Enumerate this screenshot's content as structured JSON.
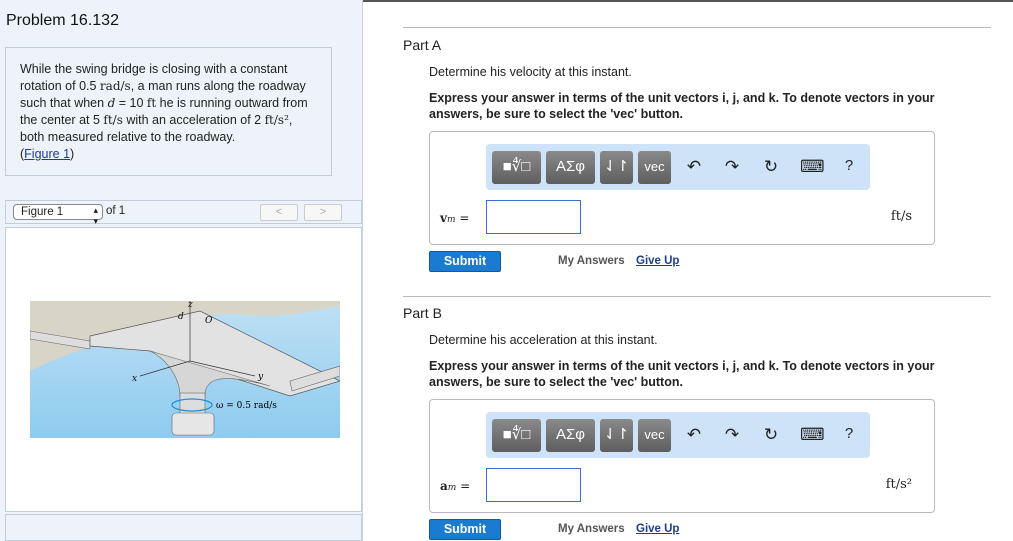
{
  "problem": {
    "title": "Problem 16.132",
    "text": {
      "p1": "While the swing bridge is closing with a constant rotation of 0.5 ",
      "m1": "rad/s",
      "p2": ", a man runs along the roadway such that when ",
      "m2": "d",
      "p3": " = 10 ",
      "m3": "ft",
      "p4": " he is running outward from the center at 5 ",
      "m4": "ft/s",
      "p5": " with an acceleration of 2 ",
      "m5": "ft/s²",
      "p6": ", both measured relative to the roadway.",
      "link_open": "(",
      "link": "Figure 1",
      "link_close": ")"
    }
  },
  "figure": {
    "select": "Figure 1",
    "of": "of 1",
    "prev": "<",
    "next": ">",
    "labels": {
      "z": "z",
      "d": "d",
      "O": "O",
      "x": "x",
      "y": "y",
      "omega": "ω = 0.5 rad/s"
    }
  },
  "toolbar": {
    "templates": "■∜□",
    "greek": "ΑΣφ",
    "arrows": "⇃↾",
    "vec": "vec",
    "undo": "↶",
    "redo": "↷",
    "reset": "↻",
    "keyboard": "⌨",
    "help": "?"
  },
  "parts": [
    {
      "title": "Part A",
      "question": "Determine his velocity at this instant.",
      "instruction": "Express your answer in terms of the unit vectors i, j, and k. To denote vectors in your answers, be sure to select the 'vec' button.",
      "var": "v",
      "sub": "m",
      "eq": " =",
      "value": "",
      "unit": "ft/s",
      "submit": "Submit",
      "my_answers": "My Answers",
      "give_up": "Give Up"
    },
    {
      "title": "Part B",
      "question": "Determine his acceleration at this instant.",
      "instruction": "Express your answer in terms of the unit vectors i, j, and k. To denote vectors in your answers, be sure to select the 'vec' button.",
      "var": "a",
      "sub": "m",
      "eq": " =",
      "value": "",
      "unit": "ft/s²",
      "submit": "Submit",
      "my_answers": "My Answers",
      "give_up": "Give Up"
    }
  ]
}
